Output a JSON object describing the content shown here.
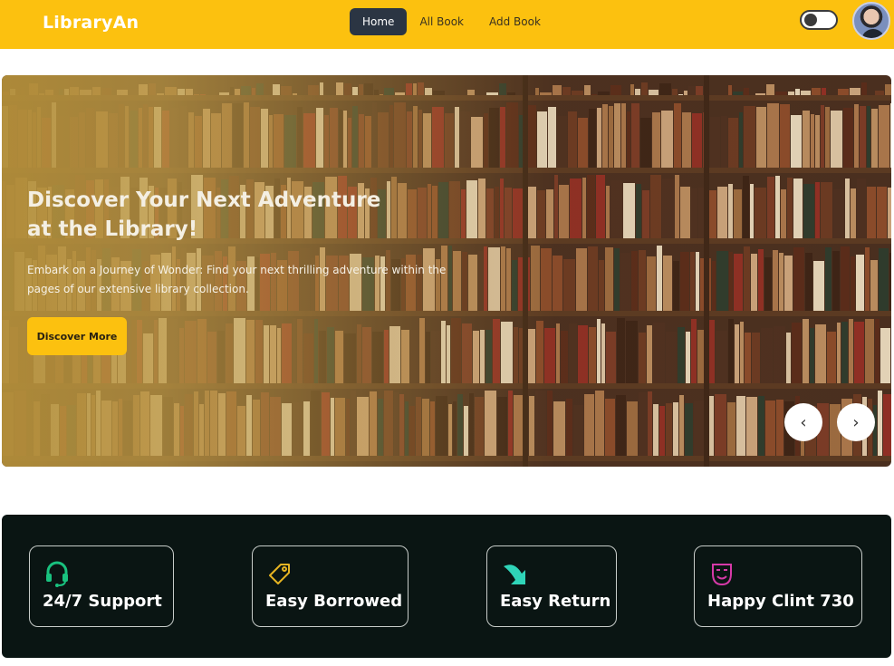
{
  "navbar": {
    "brand": "LibraryAn",
    "links": [
      {
        "label": "Home",
        "active": true
      },
      {
        "label": "All Book",
        "active": false
      },
      {
        "label": "Add Book",
        "active": false
      }
    ],
    "accent": "#fcc10f",
    "active_link_color": "#2b3543"
  },
  "hero": {
    "title": "Discover Your Next Adventure at the Library!",
    "text": "Embark on a Journey of Wonder: Find your next thrilling adventure within the pages of our extensive library collection.",
    "button_label": "Discover More",
    "prev_icon": "‹",
    "next_icon": "›"
  },
  "features": {
    "background": "#0a1513",
    "items": [
      {
        "label": "24/7 Support",
        "icon": "headset-icon",
        "icon_color": "#19c27f"
      },
      {
        "label": "Easy Borrowed",
        "icon": "tag-icon",
        "icon_color": "#e6b422"
      },
      {
        "label": "Easy Return",
        "icon": "return-arrow-icon",
        "icon_color": "#2fd4b8"
      },
      {
        "label": "Happy Clint 730",
        "icon": "masks-icon",
        "icon_color": "#d63aa8"
      }
    ]
  }
}
